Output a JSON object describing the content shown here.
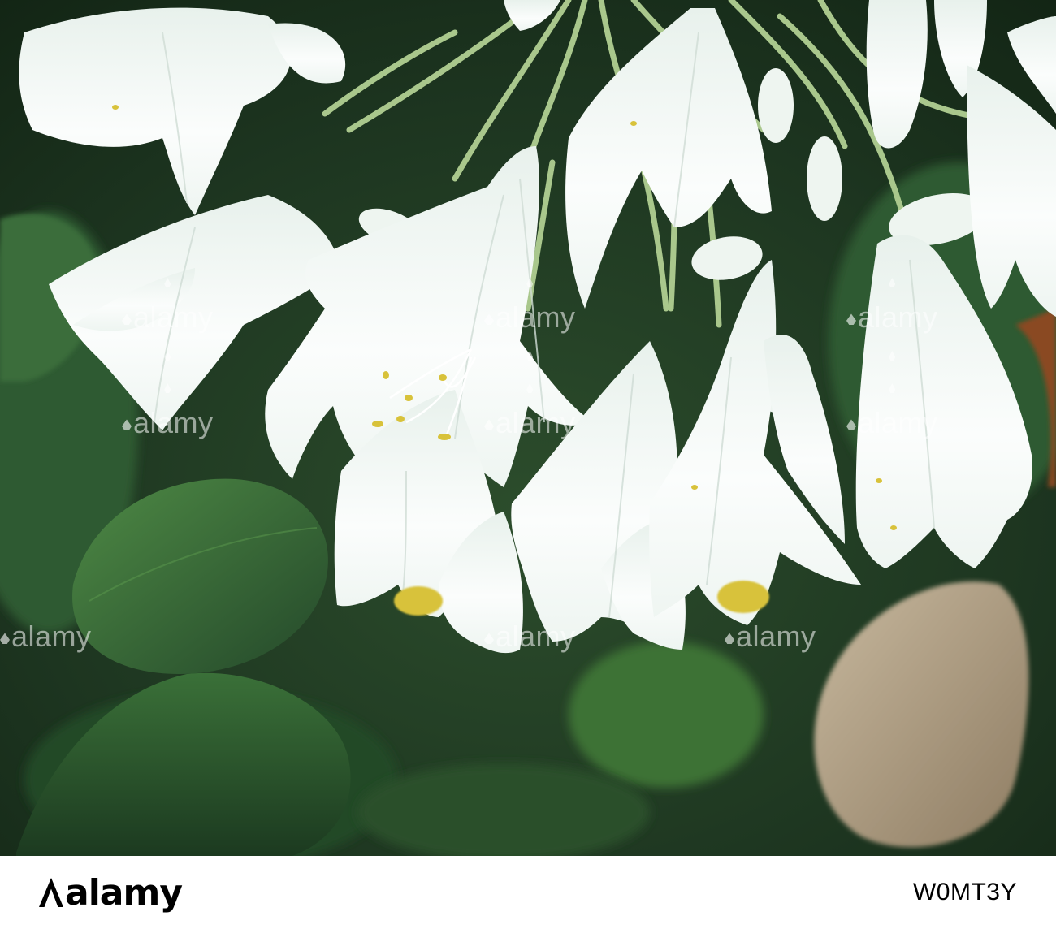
{
  "photo": {
    "subject": "white-agapanthus-flower-cluster",
    "colors": {
      "background_dark_green": "#1f3a22",
      "leaf_green": "#3f7a3a",
      "petal_white": "#f6faf8",
      "stamen_yellow": "#d8c23a",
      "stem_green": "#a7c68a",
      "dried_leaf": "#b5a58c"
    },
    "watermark_text": "alamy"
  },
  "footer": {
    "logo_text": "alamy",
    "stock_id": "W0MT3Y"
  }
}
